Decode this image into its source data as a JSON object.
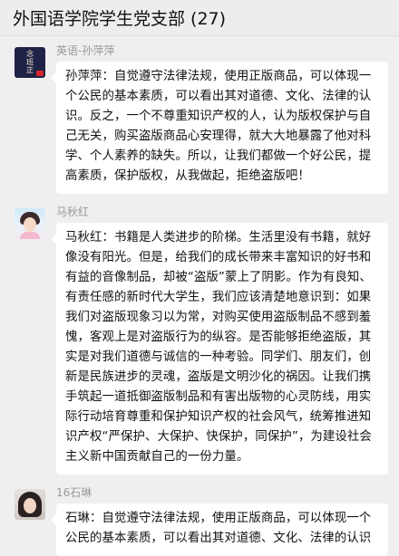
{
  "header": {
    "title": "外国语学院学生党支部 (27)"
  },
  "messages": [
    {
      "sender": "英语-孙萍萍",
      "avatar_text": [
        "念",
        "班",
        "正"
      ],
      "text": "孙萍萍：自觉遵守法律法规，使用正版商品，可以体现一个公民的基本素质，可以看出其对道德、文化、法律的认识。反之，一个不尊重知识产权的人，认为版权保护与自己无关，购买盗版商品心安理得，就大大地暴露了他对科学、个人素养的缺失。所以，让我们都做一个好公民，提高素质，保护版权，从我做起，拒绝盗版吧！"
    },
    {
      "sender": "马秋红",
      "text": "马秋红：书籍是人类进步的阶梯。生活里没有书籍，就好像没有阳光。但是，给我们的成长带来丰富知识的好书和有益的音像制品，却被“盗版”蒙上了阴影。作为有良知、有责任感的新时代大学生，我们应该清楚地意识到：如果我们对盗版现象习以为常，对购买使用盗版制品不感到羞愧，客观上是对盗版行为的纵容。是否能够拒绝盗版，其实是对我们道德与诚信的一种考验。同学们、朋友们，创新是民族进步的灵魂，盗版是文明沙化的祸因。让我们携手筑起一道抵御盗版制品和有害出版物的心灵防线，用实际行动培育尊重和保护知识产权的社会风气，统筹推进知识产权“严保护、大保护、快保护，同保护”，为建设社会主义新中国贡献自己的一份力量。"
    },
    {
      "sender": "16石琳",
      "text": "石琳：自觉遵守法律法规，使用正版商品，可以体现一个公民的基本素质，可以看出其对道德、文化、法律的认识"
    }
  ]
}
